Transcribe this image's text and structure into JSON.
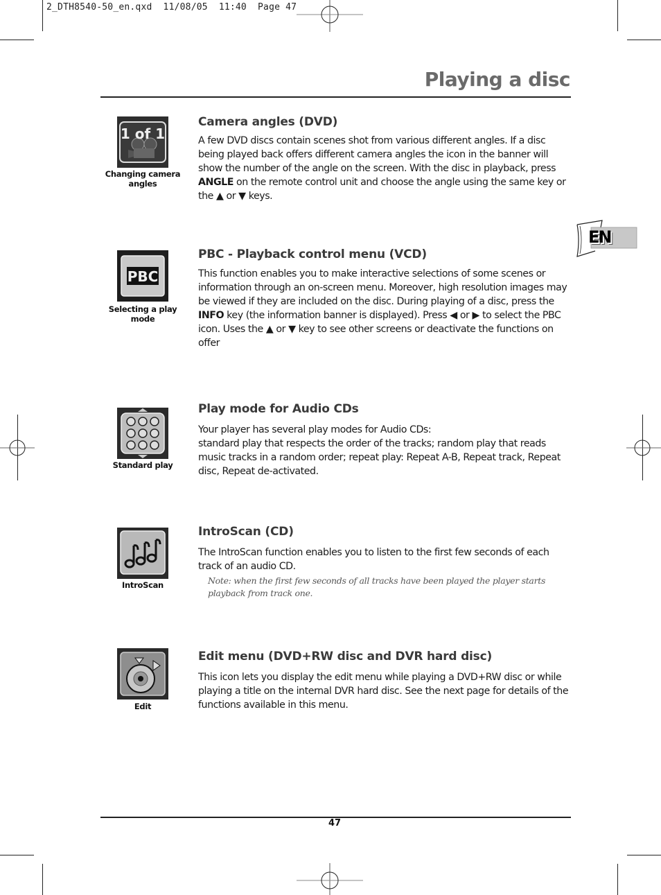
{
  "slug": {
    "text": "2_DTH8540-50_en.qxd  11/08/05  11:40  Page 47"
  },
  "header": {
    "title": "Playing a disc"
  },
  "language_tab": {
    "label": "EN"
  },
  "sections": [
    {
      "icon": "camera-angle-icon",
      "icon_text": "1 of 1",
      "caption": "Changing camera angles",
      "heading": "Camera angles (DVD)",
      "body_parts": [
        "A few DVD discs contain scenes shot from various different angles. If a disc being played back offers different camera angles the icon in the banner will show the number of the angle on the screen. With the disc in playback, press ",
        "ANGLE",
        " on the remote control unit and choose the angle using the same key or the ▲ or ▼ keys."
      ]
    },
    {
      "icon": "pbc-icon",
      "icon_text": "PBC",
      "caption": "Selecting a play mode",
      "heading": "PBC - Playback control menu (VCD)",
      "body_parts": [
        "This function enables you to make interactive selections of some scenes or information through an on-screen menu. Moreover, high resolution images may be viewed if they are included on the disc. During playing of a disc, press the ",
        "INFO",
        " key (the information banner is displayed). Press ◀ or ▶ to select the PBC icon. Uses the ▲ or ▼ key to see other screens or deactivate the functions on offer"
      ]
    },
    {
      "icon": "standard-play-icon",
      "caption": "Standard play",
      "heading": "Play mode for Audio CDs",
      "body_line1": "Your player has several play modes for Audio CDs:",
      "body_line2": "standard play that respects the order of the tracks; random play that reads music tracks in a random order; repeat play: Repeat A-B, Repeat track, Repeat disc, Repeat de-activated."
    },
    {
      "icon": "introscan-icon",
      "caption": "IntroScan",
      "heading": "IntroScan (CD)",
      "body": "The IntroScan function enables you to listen to the first few seconds of each track of an audio CD.",
      "note": "Note: when the first few seconds of all tracks have been played the player starts playback from track one."
    },
    {
      "icon": "edit-disc-icon",
      "caption": "Edit",
      "heading": "Edit menu (DVD+RW disc and DVR hard disc)",
      "body": "This icon lets you display the edit menu while playing a DVD+RW disc or while playing a title on the internal DVR hard disc. See the next page for details of the functions available in this menu."
    }
  ],
  "footer": {
    "page_number": "47"
  }
}
